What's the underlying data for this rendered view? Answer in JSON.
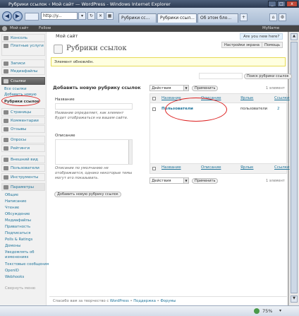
{
  "window": {
    "title": "Рубрики ссылок ‹ Мой сайт — WordPress - Windows Internet Explorer"
  },
  "browser": {
    "address": "http://y...",
    "tabs": [
      "Рубрики сс...",
      "Рубрики ссыл...",
      "Об этом бло..."
    ]
  },
  "adminbar": {
    "items": [
      "Мой сайт",
      "Follow"
    ],
    "user": "MyName"
  },
  "header": {
    "site_name": "Мой сайт",
    "howdy": "Are you new here?",
    "screen_options": "Настройки экрана",
    "help": "Помощь"
  },
  "menu": {
    "items": [
      "Консоль",
      "Платные услуги",
      "Записи",
      "Медиафайлы",
      "Ссылки",
      "Страницы",
      "Комментарии",
      "Отзывы",
      "Опросы",
      "Рейтинги",
      "Внешний вид",
      "Пользователи",
      "Инструменты",
      "Параметры"
    ],
    "links_sub": [
      "Все ссылки",
      "Добавить новую",
      "Рубрики ссылок"
    ],
    "settings_sub": [
      "Общие",
      "Написание",
      "Чтение",
      "Обсуждение",
      "Медиафайлы",
      "Приватность",
      "Подписаться",
      "Polls & Ratings",
      "Домены",
      "Уведомлять об изменениях",
      "Текстовые сообщения",
      "OpenID",
      "Webhooks"
    ],
    "collapse": "Свернуть меню"
  },
  "page": {
    "title": "Рубрики ссылок",
    "notice": "Элемент обновлён.",
    "search_button": "Поиск рубрики ссылок",
    "add": {
      "heading": "Добавить новую рубрику ссылок",
      "name_label": "Название",
      "name_hint": "Название определяет, как элемент будет отображаться на вашем сайте.",
      "desc_label": "Описание",
      "desc_hint": "Описание по умолчанию не отображается, однако некоторые темы могут его показывать.",
      "submit": "Добавить новую рубрику ссылок"
    },
    "table": {
      "bulk_action": "Действия",
      "apply": "Применить",
      "count": "1 элемент",
      "columns": [
        "Название",
        "Описание",
        "Ярлык",
        "Ссылки"
      ],
      "rows": [
        {
          "name": "Пользователи",
          "description": "",
          "slug": "пользователи",
          "links": "2"
        }
      ]
    }
  },
  "footer": {
    "left": "Спасибо вам за творчество с ",
    "wp": "WordPress",
    "sep1": " • ",
    "docs": "Поддержка",
    "sep2": " • ",
    "forums": "Форумы"
  },
  "status": {
    "zoom": "75%"
  }
}
